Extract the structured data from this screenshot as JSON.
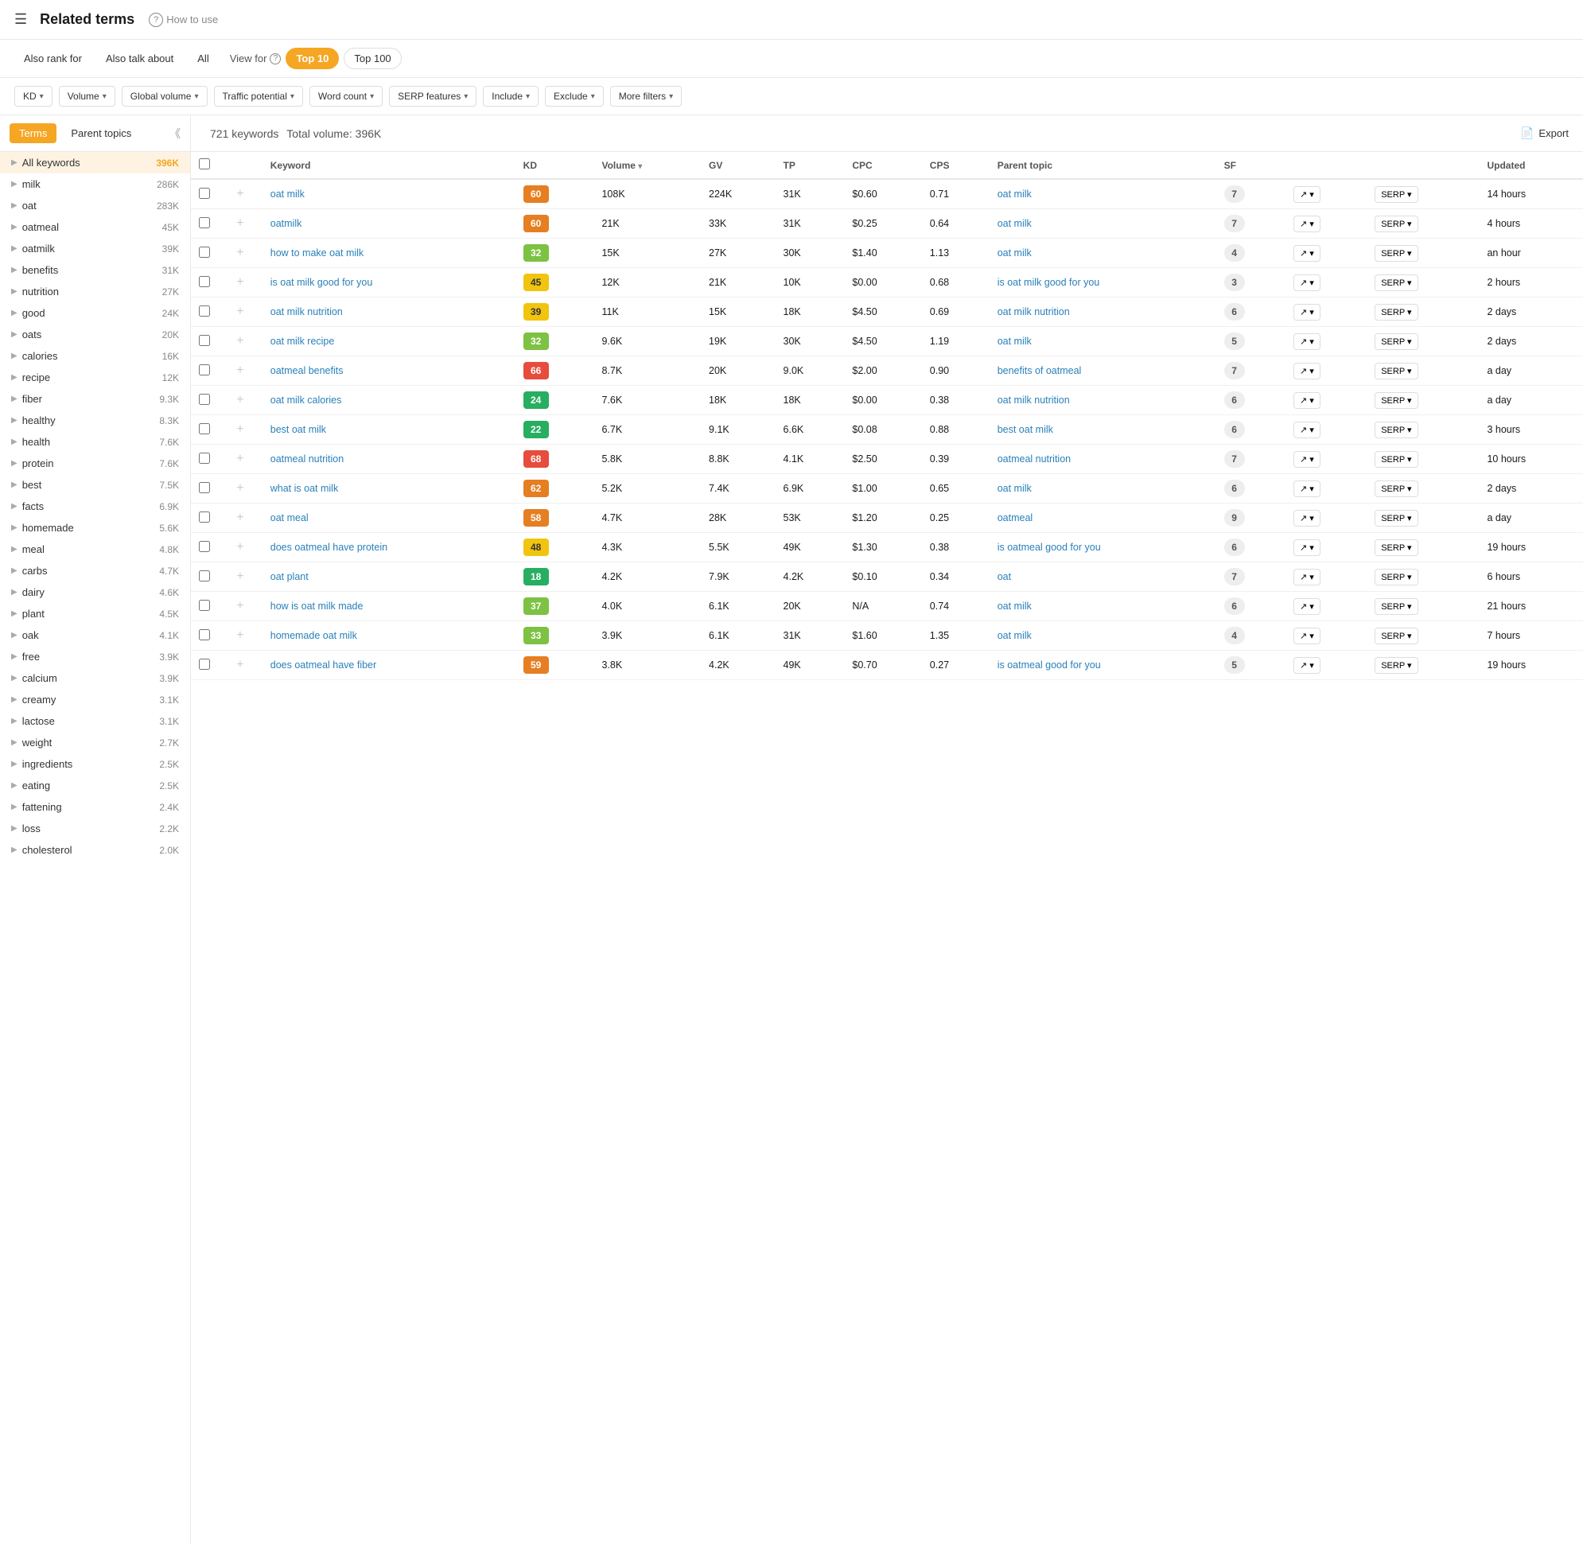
{
  "header": {
    "menu_icon": "☰",
    "title": "Related terms",
    "help_text": "How to use"
  },
  "view_bar": {
    "tabs": [
      {
        "label": "Also rank for",
        "active": false
      },
      {
        "label": "Also talk about",
        "active": false
      },
      {
        "label": "All",
        "active": false
      }
    ],
    "view_for_label": "View for",
    "view_for_options": [
      {
        "label": "Top 10",
        "active": true
      },
      {
        "label": "Top 100",
        "active": false
      }
    ]
  },
  "filters": [
    {
      "label": "KD",
      "id": "kd"
    },
    {
      "label": "Volume",
      "id": "volume"
    },
    {
      "label": "Global volume",
      "id": "global-volume"
    },
    {
      "label": "Traffic potential",
      "id": "traffic-potential"
    },
    {
      "label": "Word count",
      "id": "word-count"
    },
    {
      "label": "SERP features",
      "id": "serp-features"
    },
    {
      "label": "Include",
      "id": "include"
    },
    {
      "label": "Exclude",
      "id": "exclude"
    },
    {
      "label": "More filters",
      "id": "more-filters"
    }
  ],
  "sidebar": {
    "tab_terms": "Terms",
    "tab_parent_topics": "Parent topics",
    "items": [
      {
        "label": "All keywords",
        "count": "396K",
        "active": true
      },
      {
        "label": "milk",
        "count": "286K"
      },
      {
        "label": "oat",
        "count": "283K"
      },
      {
        "label": "oatmeal",
        "count": "45K"
      },
      {
        "label": "oatmilk",
        "count": "39K"
      },
      {
        "label": "benefits",
        "count": "31K"
      },
      {
        "label": "nutrition",
        "count": "27K"
      },
      {
        "label": "good",
        "count": "24K"
      },
      {
        "label": "oats",
        "count": "20K"
      },
      {
        "label": "calories",
        "count": "16K"
      },
      {
        "label": "recipe",
        "count": "12K"
      },
      {
        "label": "fiber",
        "count": "9.3K"
      },
      {
        "label": "healthy",
        "count": "8.3K"
      },
      {
        "label": "health",
        "count": "7.6K"
      },
      {
        "label": "protein",
        "count": "7.6K"
      },
      {
        "label": "best",
        "count": "7.5K"
      },
      {
        "label": "facts",
        "count": "6.9K"
      },
      {
        "label": "homemade",
        "count": "5.6K"
      },
      {
        "label": "meal",
        "count": "4.8K"
      },
      {
        "label": "carbs",
        "count": "4.7K"
      },
      {
        "label": "dairy",
        "count": "4.6K"
      },
      {
        "label": "plant",
        "count": "4.5K"
      },
      {
        "label": "oak",
        "count": "4.1K"
      },
      {
        "label": "free",
        "count": "3.9K"
      },
      {
        "label": "calcium",
        "count": "3.9K"
      },
      {
        "label": "creamy",
        "count": "3.1K"
      },
      {
        "label": "lactose",
        "count": "3.1K"
      },
      {
        "label": "weight",
        "count": "2.7K"
      },
      {
        "label": "ingredients",
        "count": "2.5K"
      },
      {
        "label": "eating",
        "count": "2.5K"
      },
      {
        "label": "fattening",
        "count": "2.4K"
      },
      {
        "label": "loss",
        "count": "2.2K"
      },
      {
        "label": "cholesterol",
        "count": "2.0K"
      }
    ]
  },
  "content": {
    "keywords_count": "721 keywords",
    "total_volume": "Total volume: 396K",
    "export_label": "Export",
    "columns": {
      "keyword": "Keyword",
      "kd": "KD",
      "volume": "Volume",
      "gv": "GV",
      "tp": "TP",
      "cpc": "CPC",
      "cps": "CPS",
      "parent_topic": "Parent topic",
      "sf": "SF",
      "updated": "Updated"
    },
    "rows": [
      {
        "keyword": "oat milk",
        "kd": 60,
        "kd_color": "orange",
        "volume": "108K",
        "gv": "224K",
        "tp": "31K",
        "cpc": "$0.60",
        "cps": "0.71",
        "parent_topic": "oat milk",
        "sf": 7,
        "updated": "14 hours"
      },
      {
        "keyword": "oatmilk",
        "kd": 60,
        "kd_color": "orange",
        "volume": "21K",
        "gv": "33K",
        "tp": "31K",
        "cpc": "$0.25",
        "cps": "0.64",
        "parent_topic": "oat milk",
        "sf": 7,
        "updated": "4 hours"
      },
      {
        "keyword": "how to make oat milk",
        "kd": 32,
        "kd_color": "yellow-green",
        "volume": "15K",
        "gv": "27K",
        "tp": "30K",
        "cpc": "$1.40",
        "cps": "1.13",
        "parent_topic": "oat milk",
        "sf": 4,
        "updated": "an hour"
      },
      {
        "keyword": "is oat milk good for you",
        "kd": 45,
        "kd_color": "yellow",
        "volume": "12K",
        "gv": "21K",
        "tp": "10K",
        "cpc": "$0.00",
        "cps": "0.68",
        "parent_topic": "is oat milk good for you",
        "sf": 3,
        "updated": "2 hours"
      },
      {
        "keyword": "oat milk nutrition",
        "kd": 39,
        "kd_color": "yellow",
        "volume": "11K",
        "gv": "15K",
        "tp": "18K",
        "cpc": "$4.50",
        "cps": "0.69",
        "parent_topic": "oat milk nutrition",
        "sf": 6,
        "updated": "2 days"
      },
      {
        "keyword": "oat milk recipe",
        "kd": 32,
        "kd_color": "yellow-green",
        "volume": "9.6K",
        "gv": "19K",
        "tp": "30K",
        "cpc": "$4.50",
        "cps": "1.19",
        "parent_topic": "oat milk",
        "sf": 5,
        "updated": "2 days"
      },
      {
        "keyword": "oatmeal benefits",
        "kd": 66,
        "kd_color": "red",
        "volume": "8.7K",
        "gv": "20K",
        "tp": "9.0K",
        "cpc": "$2.00",
        "cps": "0.90",
        "parent_topic": "benefits of oatmeal",
        "sf": 7,
        "updated": "a day"
      },
      {
        "keyword": "oat milk calories",
        "kd": 24,
        "kd_color": "green",
        "volume": "7.6K",
        "gv": "18K",
        "tp": "18K",
        "cpc": "$0.00",
        "cps": "0.38",
        "parent_topic": "oat milk nutrition",
        "sf": 6,
        "updated": "a day"
      },
      {
        "keyword": "best oat milk",
        "kd": 22,
        "kd_color": "green",
        "volume": "6.7K",
        "gv": "9.1K",
        "tp": "6.6K",
        "cpc": "$0.08",
        "cps": "0.88",
        "parent_topic": "best oat milk",
        "sf": 6,
        "updated": "3 hours"
      },
      {
        "keyword": "oatmeal nutrition",
        "kd": 68,
        "kd_color": "red",
        "volume": "5.8K",
        "gv": "8.8K",
        "tp": "4.1K",
        "cpc": "$2.50",
        "cps": "0.39",
        "parent_topic": "oatmeal nutrition",
        "sf": 7,
        "updated": "10 hours"
      },
      {
        "keyword": "what is oat milk",
        "kd": 62,
        "kd_color": "orange",
        "volume": "5.2K",
        "gv": "7.4K",
        "tp": "6.9K",
        "cpc": "$1.00",
        "cps": "0.65",
        "parent_topic": "oat milk",
        "sf": 6,
        "updated": "2 days"
      },
      {
        "keyword": "oat meal",
        "kd": 58,
        "kd_color": "orange",
        "volume": "4.7K",
        "gv": "28K",
        "tp": "53K",
        "cpc": "$1.20",
        "cps": "0.25",
        "parent_topic": "oatmeal",
        "sf": 9,
        "updated": "a day"
      },
      {
        "keyword": "does oatmeal have protein",
        "kd": 48,
        "kd_color": "yellow",
        "volume": "4.3K",
        "gv": "5.5K",
        "tp": "49K",
        "cpc": "$1.30",
        "cps": "0.38",
        "parent_topic": "is oatmeal good for you",
        "sf": 6,
        "updated": "19 hours"
      },
      {
        "keyword": "oat plant",
        "kd": 18,
        "kd_color": "green",
        "volume": "4.2K",
        "gv": "7.9K",
        "tp": "4.2K",
        "cpc": "$0.10",
        "cps": "0.34",
        "parent_topic": "oat",
        "sf": 7,
        "updated": "6 hours"
      },
      {
        "keyword": "how is oat milk made",
        "kd": 37,
        "kd_color": "yellow-green",
        "volume": "4.0K",
        "gv": "6.1K",
        "tp": "20K",
        "cpc": "N/A",
        "cps": "0.74",
        "parent_topic": "oat milk",
        "sf": 6,
        "updated": "21 hours"
      },
      {
        "keyword": "homemade oat milk",
        "kd": 33,
        "kd_color": "yellow-green",
        "volume": "3.9K",
        "gv": "6.1K",
        "tp": "31K",
        "cpc": "$1.60",
        "cps": "1.35",
        "parent_topic": "oat milk",
        "sf": 4,
        "updated": "7 hours"
      },
      {
        "keyword": "does oatmeal have fiber",
        "kd": 59,
        "kd_color": "orange",
        "volume": "3.8K",
        "gv": "4.2K",
        "tp": "49K",
        "cpc": "$0.70",
        "cps": "0.27",
        "parent_topic": "is oatmeal good for you",
        "sf": 5,
        "updated": "19 hours"
      }
    ]
  }
}
